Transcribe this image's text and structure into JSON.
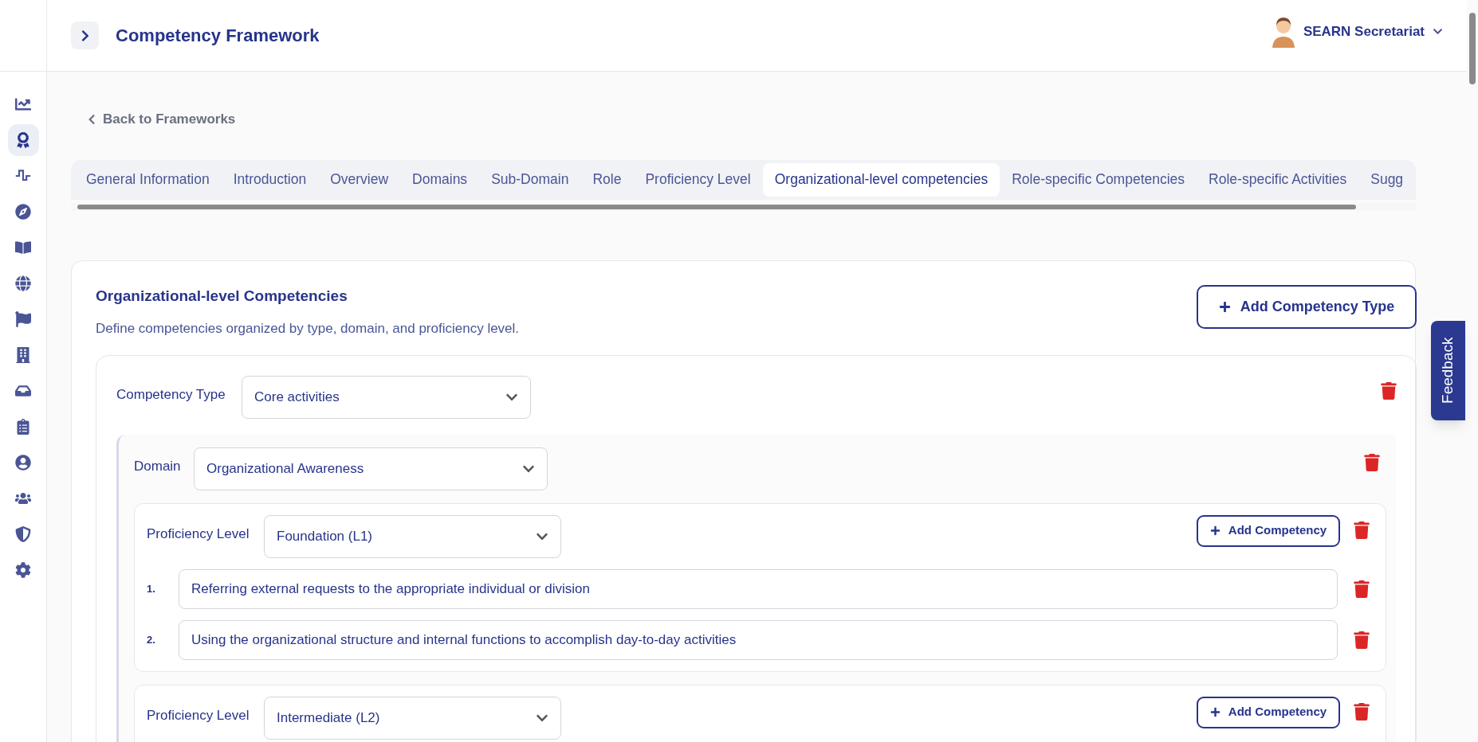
{
  "header": {
    "title": "Competency Framework",
    "user": "SEARN Secretariat"
  },
  "sidebar": {
    "items": [
      {
        "selected": false
      },
      {
        "selected": true
      },
      {
        "selected": false
      },
      {
        "selected": false
      },
      {
        "selected": false
      },
      {
        "selected": false
      },
      {
        "selected": false
      },
      {
        "selected": false
      },
      {
        "selected": false
      },
      {
        "selected": false
      },
      {
        "selected": false
      },
      {
        "selected": false
      },
      {
        "selected": false
      },
      {
        "selected": false
      }
    ]
  },
  "back_link": "Back to Frameworks",
  "tabs": [
    {
      "label": "General Information",
      "selected": false
    },
    {
      "label": "Introduction",
      "selected": false
    },
    {
      "label": "Overview",
      "selected": false
    },
    {
      "label": "Domains",
      "selected": false
    },
    {
      "label": "Sub-Domain",
      "selected": false
    },
    {
      "label": "Role",
      "selected": false
    },
    {
      "label": "Proficiency Level",
      "selected": false
    },
    {
      "label": "Organizational-level competencies",
      "selected": true
    },
    {
      "label": "Role-specific Competencies",
      "selected": false
    },
    {
      "label": "Role-specific Activities",
      "selected": false
    },
    {
      "label": "Sugg",
      "selected": false
    }
  ],
  "section": {
    "title": "Organizational-level Competencies",
    "description": "Define competencies organized by type, domain, and proficiency level.",
    "add_button": "Add Competency Type",
    "competency_types": [
      {
        "label": "Competency Type",
        "value": "Core activities",
        "domains": [
          {
            "label": "Domain",
            "value": "Organizational Awareness",
            "levels": [
              {
                "label": "Proficiency Level",
                "value": "Foundation (L1)",
                "add_button": "Add Competency",
                "competencies": [
                  {
                    "number": "1.",
                    "text": "Referring external requests to the appropriate individual or division"
                  },
                  {
                    "number": "2.",
                    "text": "Using the organizational structure and internal functions to accomplish day-to-day activities"
                  }
                ]
              },
              {
                "label": "Proficiency Level",
                "value": "Intermediate (L2)",
                "add_button": "Add Competency"
              }
            ]
          }
        ]
      }
    ]
  },
  "feedback": "Feedback"
}
